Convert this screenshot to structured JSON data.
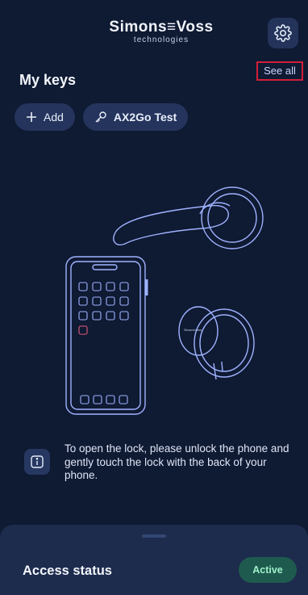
{
  "header": {
    "brand_main": "Simons≡Voss",
    "brand_sub": "technologies"
  },
  "keys": {
    "title": "My keys",
    "see_all": "See all",
    "chips": [
      {
        "label": "Add",
        "icon": "plus-icon"
      },
      {
        "label": "AX2Go Test",
        "icon": "key-icon"
      }
    ]
  },
  "illustration": {
    "knob_brand": "SimonsVoss"
  },
  "info": {
    "icon": "info-icon",
    "text": "To open the lock, please unlock the phone and gently touch the lock with the back of your phone."
  },
  "access": {
    "title": "Access status",
    "status": "Active"
  },
  "colors": {
    "background": "#0f1a33",
    "chip": "#24345c",
    "sheet": "#1d2b4d",
    "active_badge": "#1f5a4f",
    "highlight": "#d11f3a"
  }
}
